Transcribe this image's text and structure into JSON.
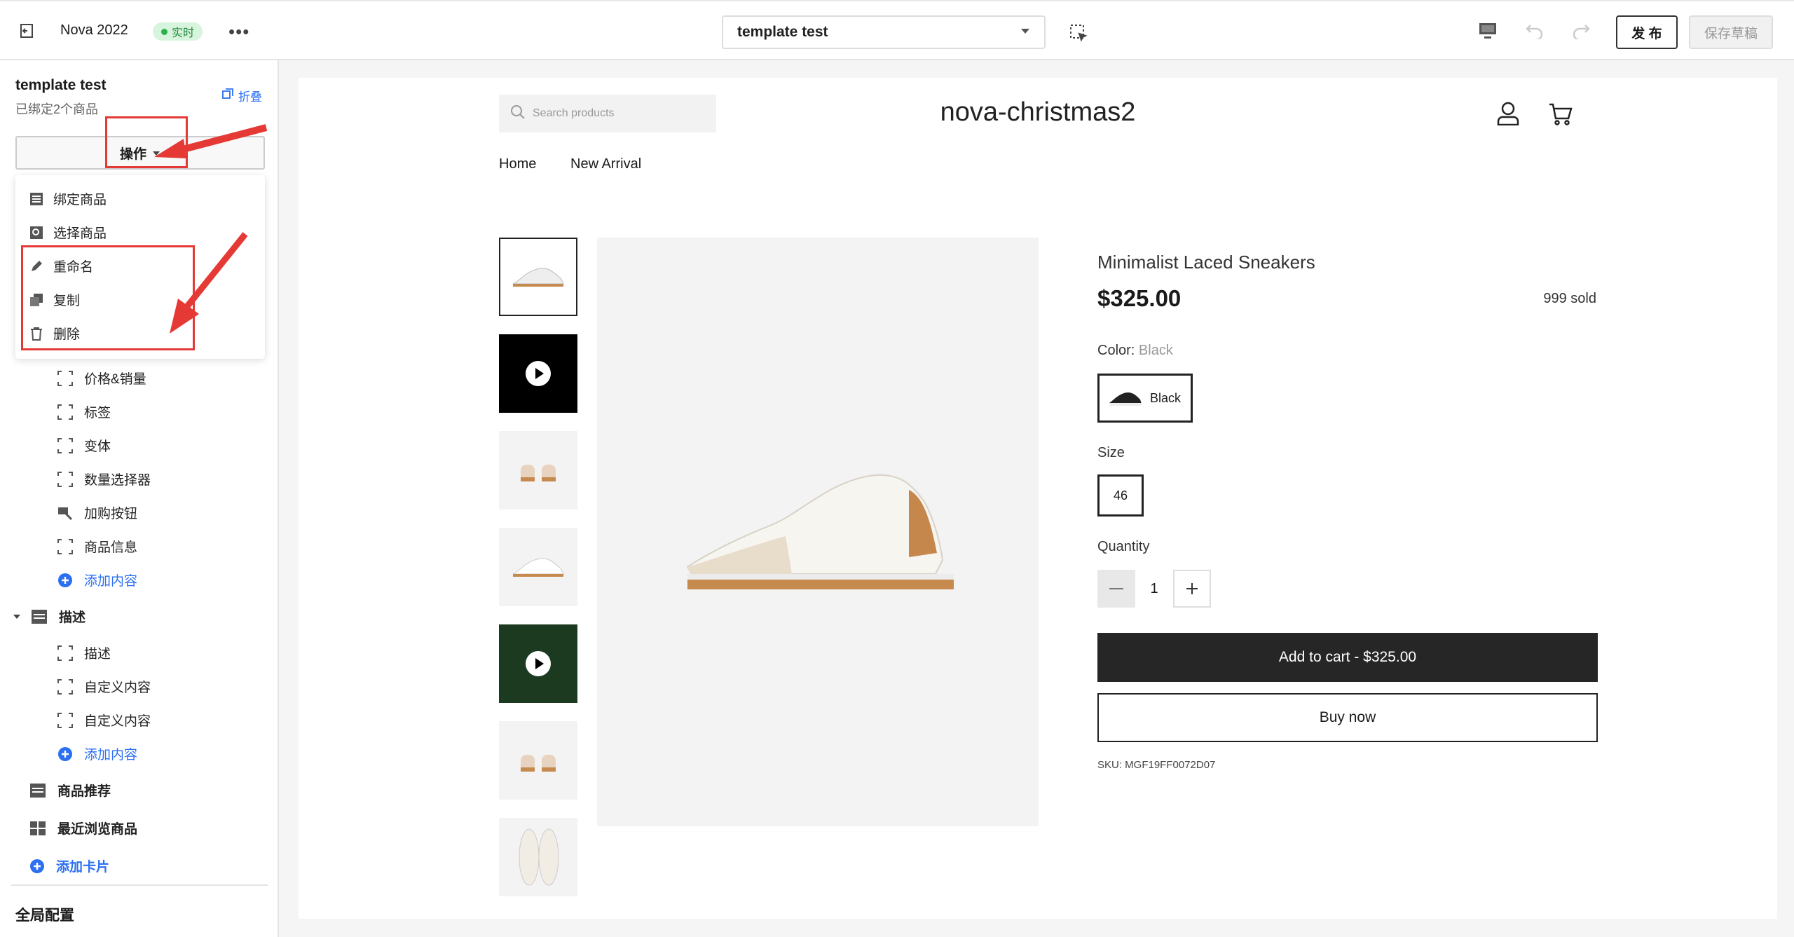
{
  "topbar": {
    "store": "Nova 2022",
    "live": "实时",
    "template_select": "template test",
    "publish": "发 布",
    "save_draft": "保存草稿"
  },
  "sidebar": {
    "title": "template test",
    "subtitle": "已绑定2个商品",
    "collapse": "折叠",
    "action_btn": "操作",
    "dropdown": [
      "绑定商品",
      "选择商品",
      "重命名",
      "复制",
      "删除"
    ],
    "blocks1": [
      "价格&销量",
      "标签",
      "变体",
      "数量选择器",
      "加购按钮",
      "商品信息"
    ],
    "add_content": "添加内容",
    "section_desc": "描述",
    "blocks2": [
      "描述",
      "自定义内容",
      "自定义内容"
    ],
    "recommend": "商品推荐",
    "recent": "最近浏览商品",
    "add_card": "添加卡片",
    "global": "全局配置"
  },
  "store": {
    "search_placeholder": "Search products",
    "name": "nova-christmas2",
    "nav": [
      "Home",
      "New Arrival"
    ]
  },
  "product": {
    "title": "Minimalist Laced Sneakers",
    "price": "$325.00",
    "sold": "999 sold",
    "color_label": "Color:",
    "color_value": "Black",
    "color_option": "Black",
    "size_label": "Size",
    "size_option": "46",
    "qty_label": "Quantity",
    "qty": "1",
    "add_cart": "Add to cart - $325.00",
    "buy_now": "Buy now",
    "sku": "SKU: MGF19FF0072D07"
  }
}
